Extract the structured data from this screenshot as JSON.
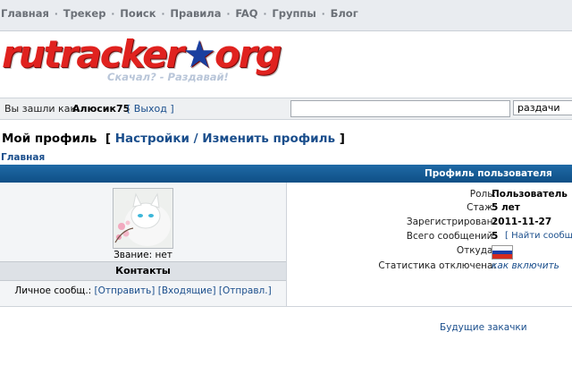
{
  "topnav": {
    "items": [
      "Главная",
      "Трекер",
      "Поиск",
      "Правила",
      "FAQ",
      "Группы",
      "Блог"
    ]
  },
  "logo": {
    "text_main": "rutracker",
    "text_dot": "★",
    "text_tld": "org",
    "slogan": "Скачал? - Раздавай!"
  },
  "loginbar": {
    "logged_as": "Вы зашли как:",
    "username": "Алюсик75",
    "logout": "[ Выход ]",
    "search_value": "",
    "search_scope": "раздачи"
  },
  "page": {
    "title": "Мой профиль",
    "settings_link": "Настройки / Изменить профиль",
    "breadcrumb": "Главная"
  },
  "profile": {
    "header": "Профиль пользователя",
    "rank_label": "Звание: нет",
    "contacts_header": "Контакты",
    "pm_label": "Личное сообщ.:",
    "pm_links": [
      "[Отправить]",
      "[Входящие]",
      "[Отправл.]"
    ],
    "info": [
      {
        "label": "Роль:",
        "value": "Пользователь"
      },
      {
        "label": "Стаж:",
        "value": "5 лет"
      },
      {
        "label": "Зарегистрирован:",
        "value": "2011-11-27"
      },
      {
        "label": "Всего сообщений:",
        "value": "5",
        "extra": "[ Найти сообщени"
      },
      {
        "label": "Откуда:",
        "value": ""
      },
      {
        "label": "Статистика отключена:",
        "value": "как включить"
      }
    ],
    "flag_colors": [
      "#ffffff",
      "#1c3fa8",
      "#d52b1e"
    ]
  },
  "footer": {
    "future_downloads": "Будущие закачки"
  },
  "colors": {
    "header_blue": "#0f4f86",
    "link_blue": "#1a4e8c",
    "logo_red": "#e0221f"
  }
}
